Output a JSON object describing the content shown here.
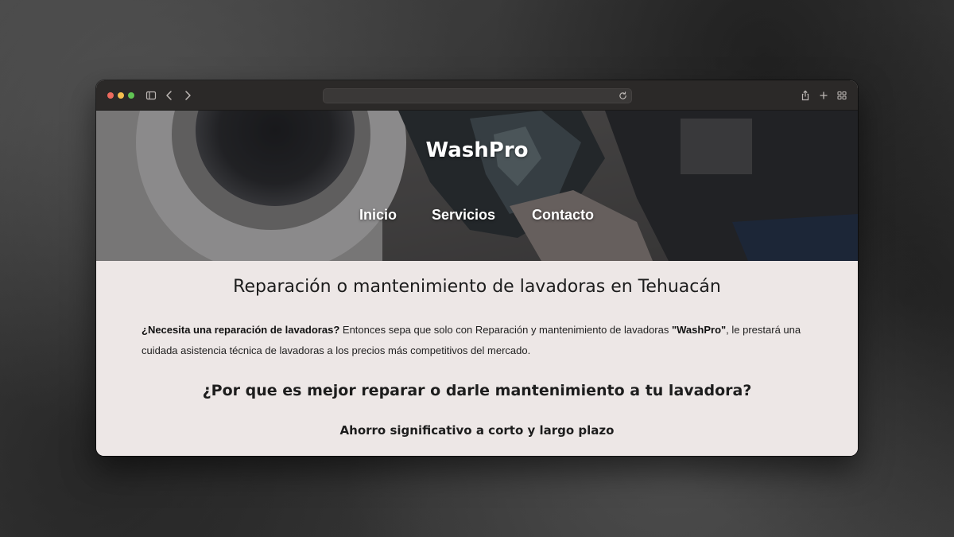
{
  "browser": {
    "icons": {
      "sidebar": "sidebar-toggle-icon",
      "back": "chevron-left-icon",
      "forward": "chevron-right-icon",
      "reload": "reload-icon",
      "share": "share-icon",
      "new_tab": "plus-icon",
      "tab_overview": "tab-grid-icon"
    },
    "address": ""
  },
  "site": {
    "brand": "WashPro",
    "nav": [
      {
        "label": "Inicio"
      },
      {
        "label": "Servicios"
      },
      {
        "label": "Contacto"
      }
    ]
  },
  "main": {
    "title": "Reparación o mantenimiento de lavadoras en Tehuacán",
    "intro": {
      "lead_bold": "¿Necesita una reparación de lavadoras?",
      "text_1": " Entonces sepa que solo con Reparación y mantenimiento de lavadoras ",
      "brand_quote": "\"WashPro\"",
      "text_2": ", le prestará una cuidada asistencia técnica de lavadoras a los precios más competitivos del mercado."
    },
    "subtitle": "¿Por que es mejor reparar o darle mantenimiento a tu lavadora?",
    "benefit": "Ahorro significativo a corto y largo plazo"
  },
  "colors": {
    "content_bg": "#ede7e6",
    "toolbar_bg": "#2b2928",
    "close": "#ed6a5e",
    "minimize": "#f5bf4f",
    "maximize": "#61c554"
  }
}
